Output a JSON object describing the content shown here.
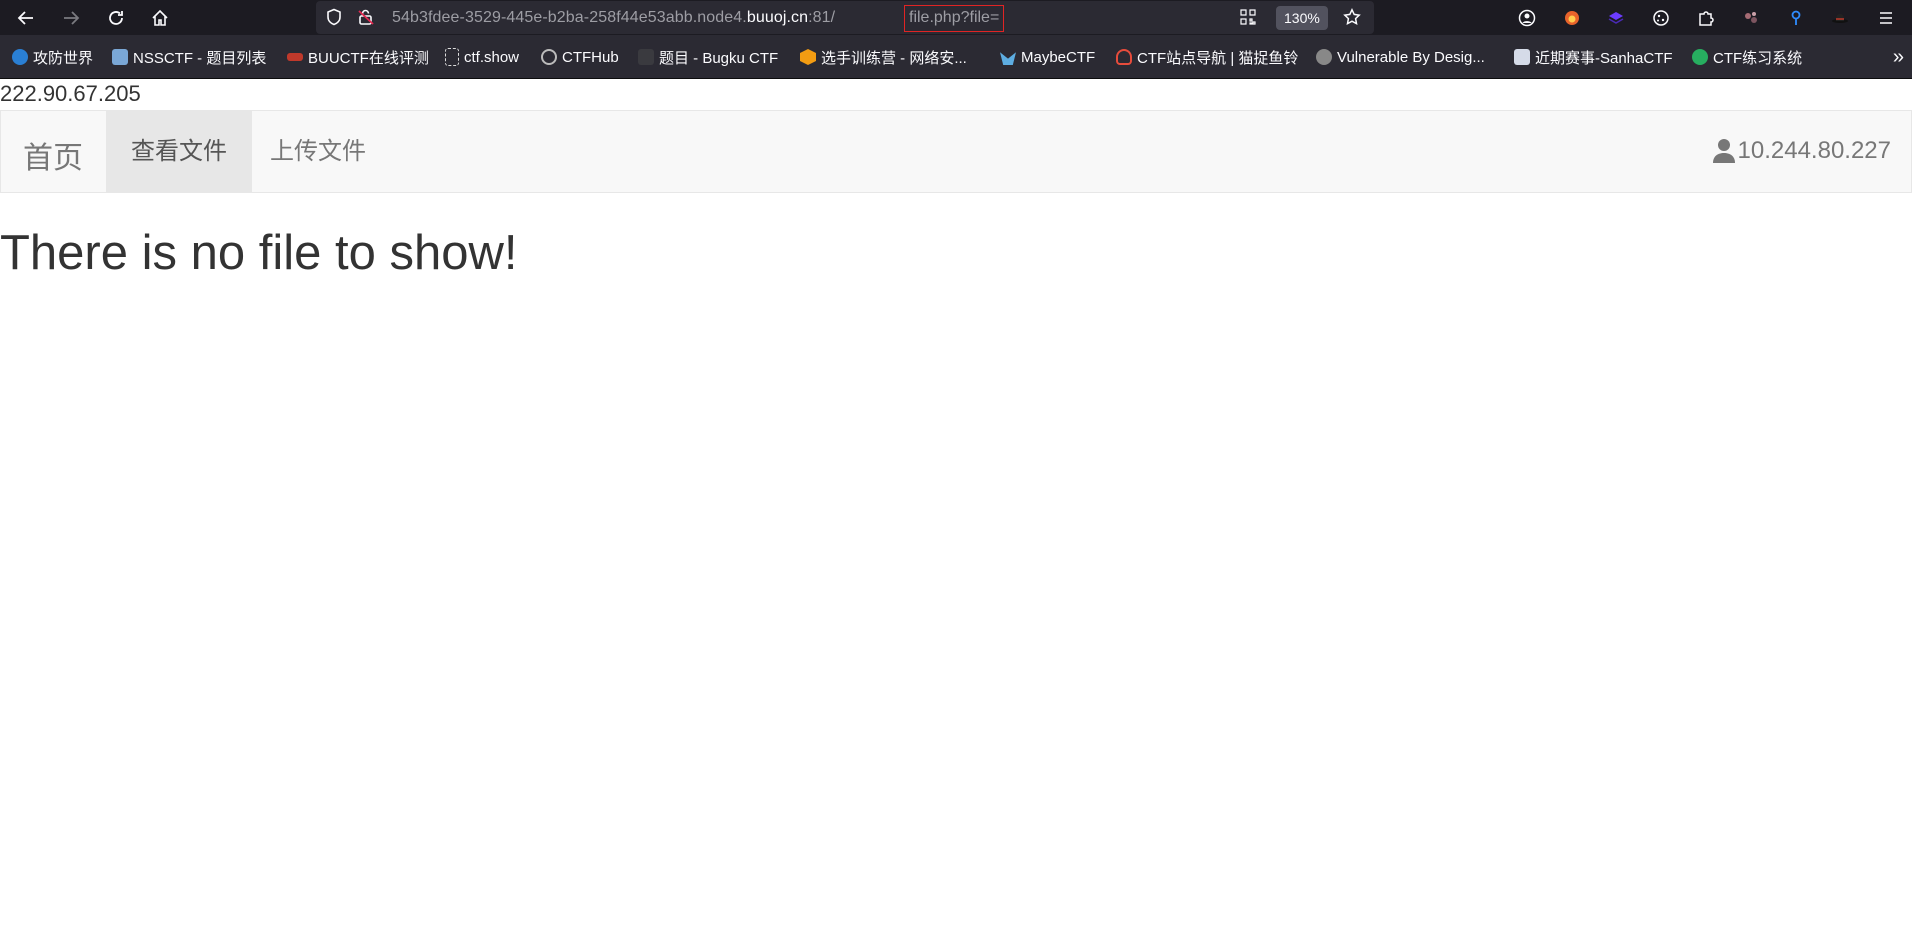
{
  "browser": {
    "url_prefix": "54b3fdee-3529-445e-b2ba-258f44e53abb.node4.",
    "url_host": "buuoj.cn",
    "url_port": ":81/",
    "url_path": "file.php?file=",
    "zoom": "130%",
    "highlight_color": "#e02424"
  },
  "bookmarks": [
    {
      "label": "攻防世界",
      "icon": "adworld-icon",
      "color": "#2a7fd4"
    },
    {
      "label": "NSSCTF - 题目列表",
      "icon": "nssctf-icon",
      "color": "#7aa7d6"
    },
    {
      "label": "BUUCTF在线评测",
      "icon": "buuctf-icon",
      "color": "#c0392b"
    },
    {
      "label": "ctf.show",
      "icon": "ctfshow-icon",
      "color": "#ddd"
    },
    {
      "label": "CTFHub",
      "icon": "ctfhub-icon",
      "color": "#bbb"
    },
    {
      "label": "题目 - Bugku CTF",
      "icon": "bugku-icon",
      "color": "#555"
    },
    {
      "label": "选手训练营 - 网络安...",
      "icon": "training-icon",
      "color": "#f39c12"
    },
    {
      "label": "MaybeCTF",
      "icon": "maybectf-icon",
      "color": "#5dade2"
    },
    {
      "label": "CTF站点导航 | 猫捉鱼铃",
      "icon": "navigation-icon",
      "color": "#e74c3c"
    },
    {
      "label": "Vulnerable By Desig...",
      "icon": "vulnhub-icon",
      "color": "#888"
    },
    {
      "label": "近期赛事-SanhaCTF",
      "icon": "sanhactf-icon",
      "color": "#d5dbe8"
    },
    {
      "label": "CTF练习系统",
      "icon": "practice-icon",
      "color": "#27ae60"
    }
  ],
  "page": {
    "client_ip": "222.90.67.205",
    "nav": {
      "brand": "首页",
      "items": [
        "查看文件",
        "上传文件"
      ],
      "active_index": 0,
      "user_ip": "10.244.80.227"
    },
    "message": "There is no file to show!"
  }
}
